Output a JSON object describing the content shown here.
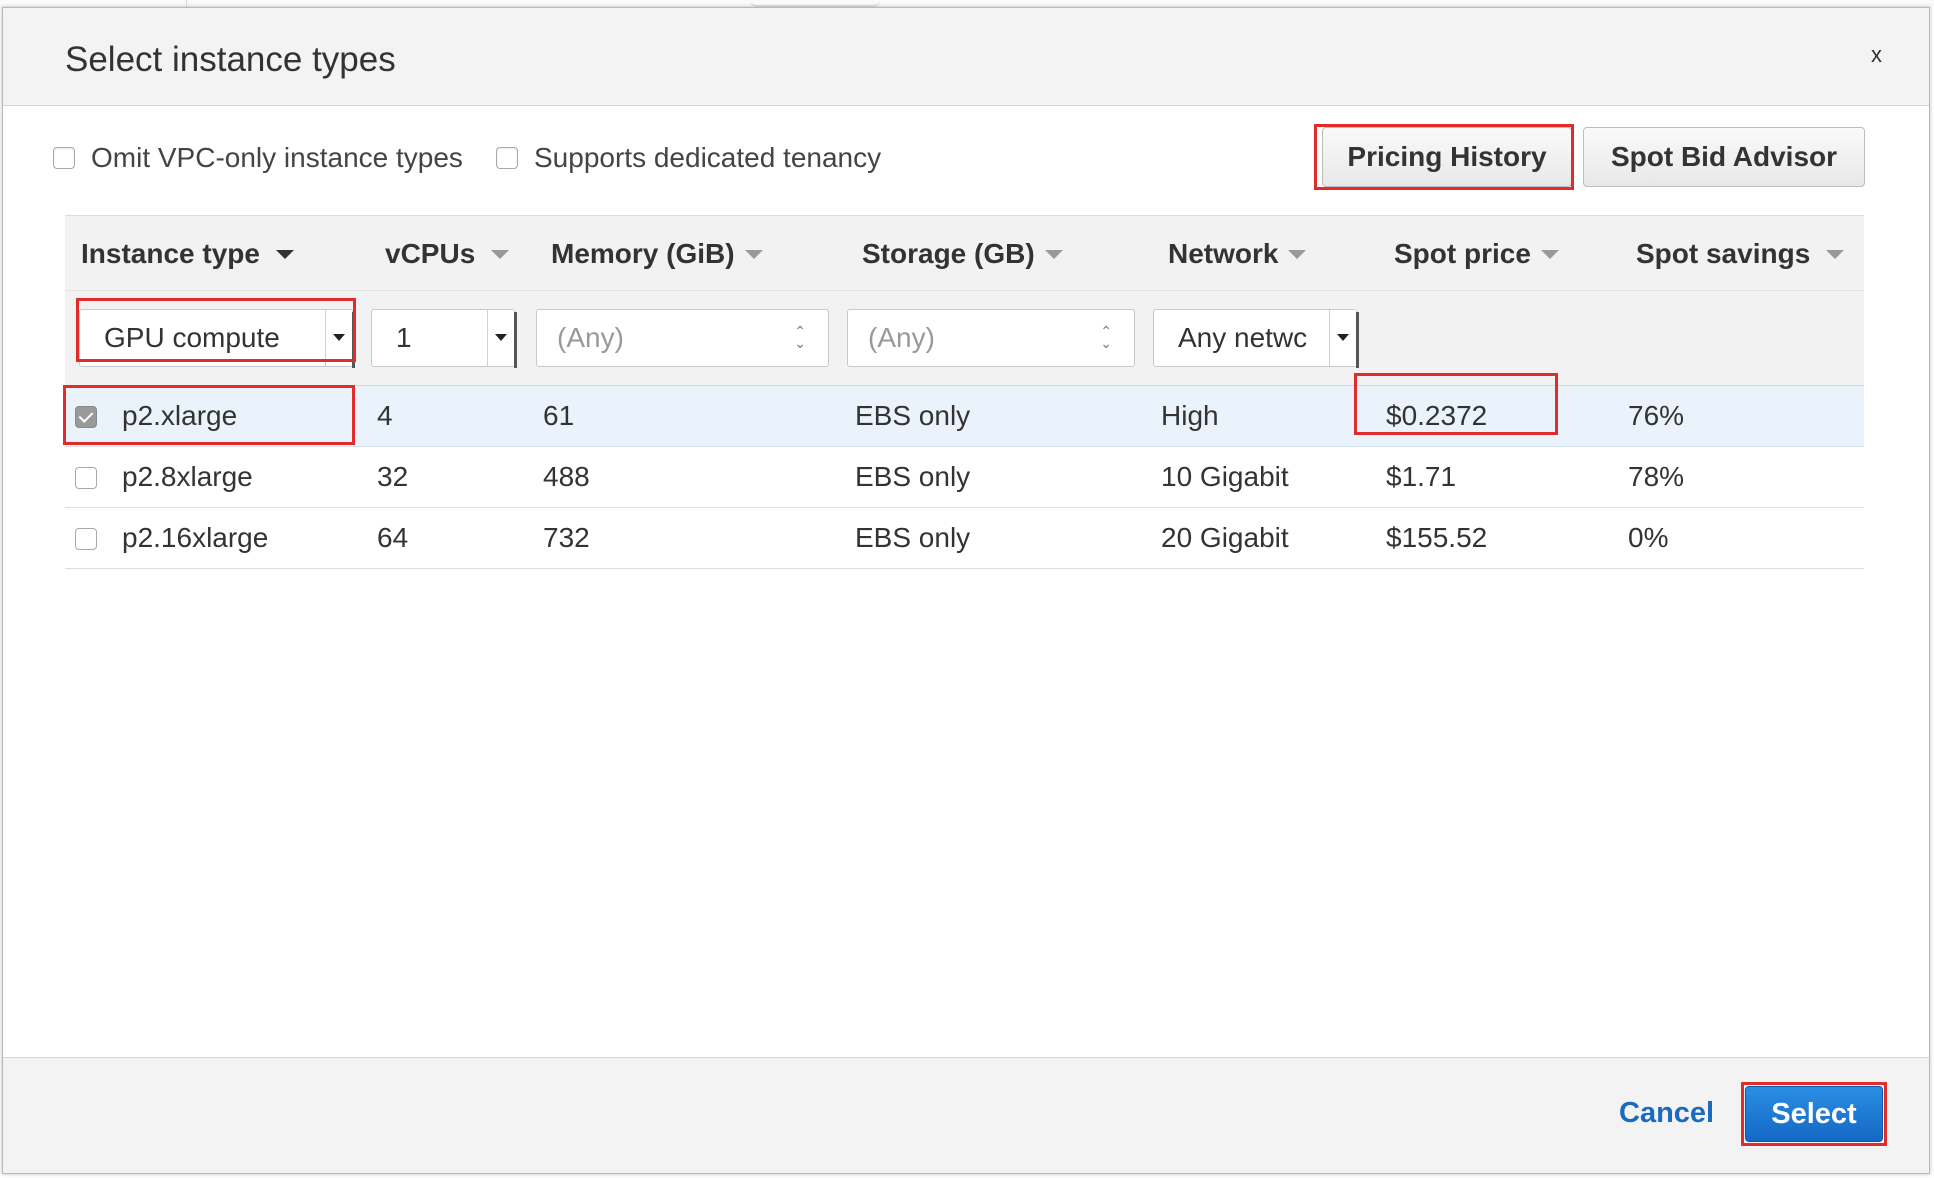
{
  "dialog": {
    "title": "Select instance types",
    "close_label": "x"
  },
  "options": {
    "omit_vpc_label": "Omit VPC-only instance types",
    "dedicated_tenancy_label": "Supports dedicated tenancy"
  },
  "toolbar": {
    "pricing_history_label": "Pricing History",
    "spot_bid_advisor_label": "Spot Bid Advisor"
  },
  "table": {
    "headers": [
      "Instance type",
      "vCPUs",
      "Memory (GiB)",
      "Storage (GB)",
      "Network",
      "Spot price",
      "Spot savings"
    ],
    "filters": {
      "instance_type": "GPU compute",
      "vcpus": "1",
      "memory_placeholder": "(Any)",
      "storage_placeholder": "(Any)",
      "network": "Any netwc"
    },
    "rows": [
      {
        "selected": true,
        "cells": [
          "p2.xlarge",
          "4",
          "61",
          "EBS only",
          "High",
          "$0.2372",
          "76%"
        ]
      },
      {
        "selected": false,
        "cells": [
          "p2.8xlarge",
          "32",
          "488",
          "EBS only",
          "10 Gigabit",
          "$1.71",
          "78%"
        ]
      },
      {
        "selected": false,
        "cells": [
          "p2.16xlarge",
          "64",
          "732",
          "EBS only",
          "20 Gigabit",
          "$155.52",
          "0%"
        ]
      }
    ]
  },
  "footer": {
    "cancel_label": "Cancel",
    "select_label": "Select"
  },
  "colors": {
    "accent": "#1a6bbf",
    "highlight": "#e22b2b",
    "selected_row": "#eaf3fb"
  }
}
